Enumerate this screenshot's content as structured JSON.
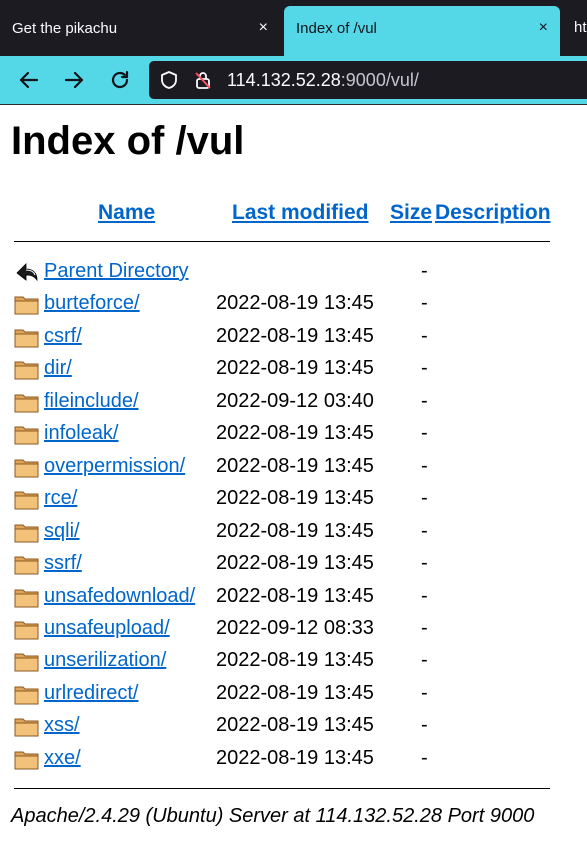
{
  "browser": {
    "tabs": [
      {
        "title": "Get the pikachu",
        "close": "×"
      },
      {
        "title": "Index of /vul",
        "close": "×"
      }
    ],
    "tab_peek": "ht",
    "url": {
      "host": "114.132.52.28",
      "rest": ":9000/vul/"
    },
    "accent_color": "#54d8e8"
  },
  "page": {
    "title": "Index of /vul",
    "columns": {
      "name": "Name",
      "modified": "Last modified",
      "size": "Size",
      "description": "Description"
    },
    "entries": [
      {
        "name": "Parent Directory",
        "date": "",
        "size": "-",
        "icon": "back-icon"
      },
      {
        "name": "burteforce/",
        "date": "2022-08-19 13:45",
        "size": "-",
        "icon": "folder-icon"
      },
      {
        "name": "csrf/",
        "date": "2022-08-19 13:45",
        "size": "-",
        "icon": "folder-icon"
      },
      {
        "name": "dir/",
        "date": "2022-08-19 13:45",
        "size": "-",
        "icon": "folder-icon"
      },
      {
        "name": "fileinclude/",
        "date": "2022-09-12 03:40",
        "size": "-",
        "icon": "folder-icon"
      },
      {
        "name": "infoleak/",
        "date": "2022-08-19 13:45",
        "size": "-",
        "icon": "folder-icon"
      },
      {
        "name": "overpermission/",
        "date": "2022-08-19 13:45",
        "size": "-",
        "icon": "folder-icon"
      },
      {
        "name": "rce/",
        "date": "2022-08-19 13:45",
        "size": "-",
        "icon": "folder-icon"
      },
      {
        "name": "sqli/",
        "date": "2022-08-19 13:45",
        "size": "-",
        "icon": "folder-icon"
      },
      {
        "name": "ssrf/",
        "date": "2022-08-19 13:45",
        "size": "-",
        "icon": "folder-icon"
      },
      {
        "name": "unsafedownload/",
        "date": "2022-08-19 13:45",
        "size": "-",
        "icon": "folder-icon"
      },
      {
        "name": "unsafeupload/",
        "date": "2022-09-12 08:33",
        "size": "-",
        "icon": "folder-icon"
      },
      {
        "name": "unserilization/",
        "date": "2022-08-19 13:45",
        "size": "-",
        "icon": "folder-icon"
      },
      {
        "name": "urlredirect/",
        "date": "2022-08-19 13:45",
        "size": "-",
        "icon": "folder-icon"
      },
      {
        "name": "xss/",
        "date": "2022-08-19 13:45",
        "size": "-",
        "icon": "folder-icon"
      },
      {
        "name": "xxe/",
        "date": "2022-08-19 13:45",
        "size": "-",
        "icon": "folder-icon"
      }
    ],
    "footer": "Apache/2.4.29 (Ubuntu) Server at 114.132.52.28 Port 9000"
  }
}
